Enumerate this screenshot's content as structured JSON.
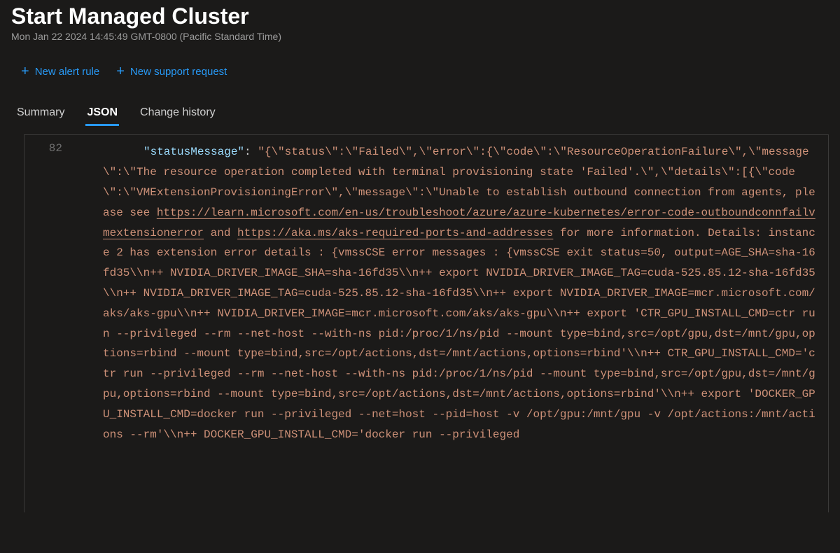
{
  "header": {
    "title": "Start Managed Cluster",
    "timestamp": "Mon Jan 22 2024 14:45:49 GMT-0800 (Pacific Standard Time)"
  },
  "toolbar": {
    "new_alert_label": "New alert rule",
    "new_support_label": "New support request"
  },
  "tabs": {
    "summary": "Summary",
    "json": "JSON",
    "change_history": "Change history",
    "active": "json"
  },
  "code": {
    "line_number": "82",
    "key_name": "\"statusMessage\"",
    "value_prefix": "\"{\\\"status\\\":\\\"Failed\\\",\\\"error\\\":{\\\"code\\\":\\\"ResourceOperationFailure\\\",\\\"message\\\":\\\"The resource operation completed with terminal provisioning state 'Failed'.\\\",\\\"details\\\":[{\\\"code\\\":\\\"VMExtensionProvisioningError\\\",\\\"message\\\":\\\"Unable to establish outbound connection from agents, please see ",
    "link1_text": "https://learn.microsoft.com/en-us/troubleshoot/azure/azure-kubernetes/error-code-outboundconnfailvmextensionerror",
    "between_links": " and ",
    "link2_text": "https://aka.ms/aks-required-ports-and-addresses",
    "value_suffix": " for more information. Details: instance 2 has extension error details : {vmssCSE error messages : {vmssCSE exit status=50, output=AGE_SHA=sha-16fd35\\\\n++ NVIDIA_DRIVER_IMAGE_SHA=sha-16fd35\\\\n++ export NVIDIA_DRIVER_IMAGE_TAG=cuda-525.85.12-sha-16fd35\\\\n++ NVIDIA_DRIVER_IMAGE_TAG=cuda-525.85.12-sha-16fd35\\\\n++ export NVIDIA_DRIVER_IMAGE=mcr.microsoft.com/aks/aks-gpu\\\\n++ NVIDIA_DRIVER_IMAGE=mcr.microsoft.com/aks/aks-gpu\\\\n++ export 'CTR_GPU_INSTALL_CMD=ctr run --privileged --rm --net-host --with-ns pid:/proc/1/ns/pid --mount type=bind,src=/opt/gpu,dst=/mnt/gpu,options=rbind --mount type=bind,src=/opt/actions,dst=/mnt/actions,options=rbind'\\\\n++ CTR_GPU_INSTALL_CMD='ctr run --privileged --rm --net-host --with-ns pid:/proc/1/ns/pid --mount type=bind,src=/opt/gpu,dst=/mnt/gpu,options=rbind --mount type=bind,src=/opt/actions,dst=/mnt/actions,options=rbind'\\\\n++ export 'DOCKER_GPU_INSTALL_CMD=docker run --privileged --net=host --pid=host -v /opt/gpu:/mnt/gpu -v /opt/actions:/mnt/actions --rm'\\\\n++ DOCKER_GPU_INSTALL_CMD='docker run --privileged"
  }
}
